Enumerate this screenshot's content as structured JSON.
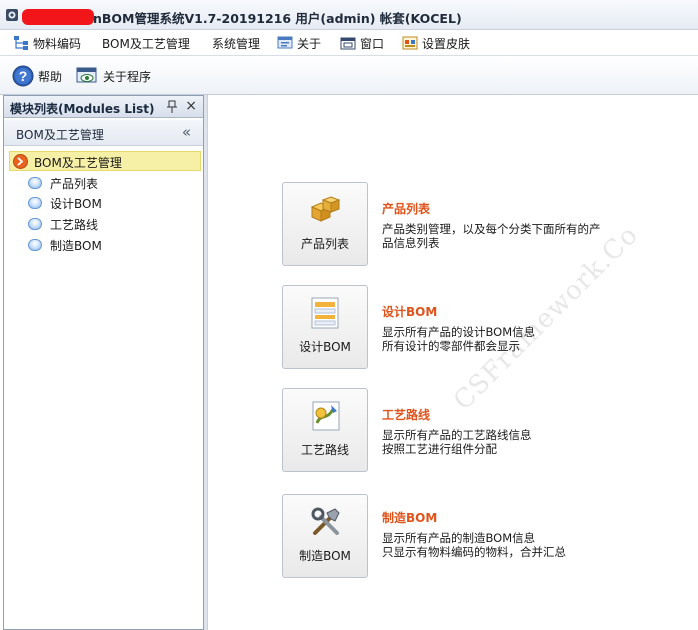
{
  "window": {
    "title": "nBOM管理系统V1.7-20191216 用户(admin) 帐套(KOCEL)"
  },
  "menu": {
    "items": [
      {
        "label": "物料编码",
        "icon": "tree-icon"
      },
      {
        "label": "BOM及工艺管理",
        "icon": ""
      },
      {
        "label": "系统管理",
        "icon": ""
      },
      {
        "label": "关于",
        "icon": "about-icon"
      },
      {
        "label": "窗口",
        "icon": "window-icon"
      },
      {
        "label": "设置皮肤",
        "icon": "skin-icon"
      }
    ]
  },
  "toolbar": {
    "help_label": "帮助",
    "about_label": "关于程序"
  },
  "panel": {
    "title": "模块列表(Modules List)",
    "group_title": "BOM及工艺管理",
    "collapse_glyph": "«",
    "close_glyph": "×",
    "tree_root": "BOM及工艺管理",
    "tree_items": [
      "产品列表",
      "设计BOM",
      "工艺路线",
      "制造BOM"
    ]
  },
  "main": {
    "cards": [
      {
        "label": "产品列表",
        "title": "产品列表",
        "lines": [
          "产品类别管理，以及每个分类下面所有的产",
          "品信息列表"
        ],
        "icon": "boxes-icon"
      },
      {
        "label": "设计BOM",
        "title": "设计BOM",
        "lines": [
          "显示所有产品的设计BOM信息",
          "所有设计的零部件都会显示"
        ],
        "icon": "list-document-icon"
      },
      {
        "label": "工艺路线",
        "title": "工艺路线",
        "lines": [
          "显示所有产品的工艺路线信息",
          "按照工艺进行组件分配"
        ],
        "icon": "route-icon"
      },
      {
        "label": "制造BOM",
        "title": "制造BOM",
        "lines": [
          "显示所有产品的制造BOM信息",
          "只显示有物料编码的物料，合并汇总"
        ],
        "icon": "tools-icon"
      }
    ],
    "watermark": "CSFramework.Co"
  },
  "colors": {
    "accent_title": "#e0531b",
    "selected_row": "#f6f0a6",
    "redaction": "#f2151a"
  }
}
